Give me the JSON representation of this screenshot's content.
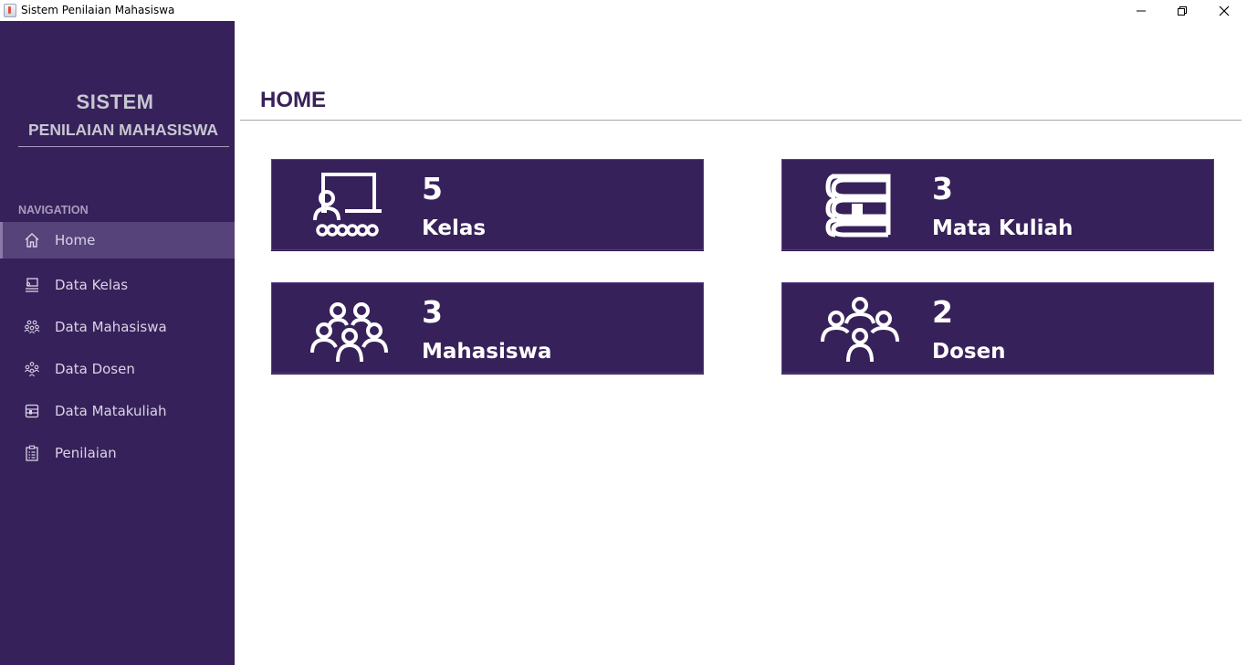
{
  "window": {
    "title": "Sistem Penilaian Mahasiswa",
    "controls": [
      "minimize",
      "maximize",
      "close"
    ]
  },
  "sidebar": {
    "brand_line1": "SISTEM",
    "brand_line2": "PENILAIAN MAHASISWA",
    "nav_heading": "NAVIGATION",
    "items": [
      {
        "label": "Home",
        "icon": "home-icon",
        "active": true
      },
      {
        "label": "Data Kelas",
        "icon": "classroom-icon"
      },
      {
        "label": "Data Mahasiswa",
        "icon": "students-icon"
      },
      {
        "label": "Data Dosen",
        "icon": "lecturers-icon"
      },
      {
        "label": "Data Matakuliah",
        "icon": "course-book-icon"
      },
      {
        "label": "Penilaian",
        "icon": "clipboard-icon"
      }
    ]
  },
  "main": {
    "title": "HOME",
    "cards": {
      "kelas": {
        "count": "5",
        "label": "Kelas",
        "icon": "classroom-icon"
      },
      "matkul": {
        "count": "3",
        "label": "Mata Kuliah",
        "icon": "book-icon"
      },
      "mahasiswa": {
        "count": "3",
        "label": "Mahasiswa",
        "icon": "students-group-icon"
      },
      "dosen": {
        "count": "2",
        "label": "Dosen",
        "icon": "lecturers-group-icon"
      }
    }
  },
  "colors": {
    "sidebar_bg": "#37215a",
    "active_item_bg": "#56437a",
    "card_bg": "#37215a",
    "title_color": "#37215a",
    "text_light": "#ffffff"
  }
}
